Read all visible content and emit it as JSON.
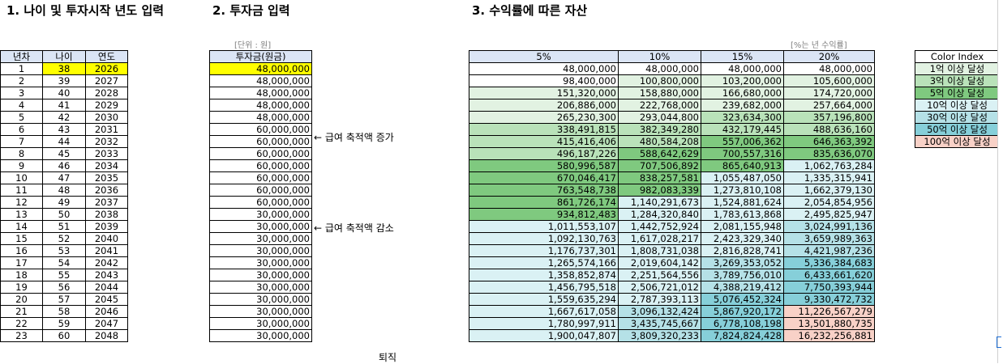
{
  "headings": {
    "h1": "1. 나이 및 투자시작 년도 입력",
    "h2": "2. 투자금 입력",
    "h3": "3. 수익률에 따른 자산"
  },
  "units": {
    "invest": "[단위 : 원]",
    "rate": "[%는 년 수익률]"
  },
  "age_table": {
    "headers": [
      "년차",
      "나이",
      "연도"
    ],
    "rows": [
      [
        "1",
        "38",
        "2026"
      ],
      [
        "2",
        "39",
        "2027"
      ],
      [
        "3",
        "40",
        "2028"
      ],
      [
        "4",
        "41",
        "2029"
      ],
      [
        "5",
        "42",
        "2030"
      ],
      [
        "6",
        "43",
        "2031"
      ],
      [
        "7",
        "44",
        "2032"
      ],
      [
        "8",
        "45",
        "2033"
      ],
      [
        "9",
        "46",
        "2034"
      ],
      [
        "10",
        "47",
        "2035"
      ],
      [
        "11",
        "48",
        "2036"
      ],
      [
        "12",
        "49",
        "2037"
      ],
      [
        "13",
        "50",
        "2038"
      ],
      [
        "14",
        "51",
        "2039"
      ],
      [
        "15",
        "52",
        "2040"
      ],
      [
        "16",
        "53",
        "2041"
      ],
      [
        "17",
        "54",
        "2042"
      ],
      [
        "18",
        "55",
        "2043"
      ],
      [
        "19",
        "56",
        "2044"
      ],
      [
        "20",
        "57",
        "2045"
      ],
      [
        "21",
        "58",
        "2046"
      ],
      [
        "22",
        "59",
        "2047"
      ],
      [
        "23",
        "60",
        "2048"
      ]
    ]
  },
  "invest_table": {
    "header": "투자금(원금)",
    "values": [
      "48,000,000",
      "48,000,000",
      "48,000,000",
      "48,000,000",
      "48,000,000",
      "60,000,000",
      "60,000,000",
      "60,000,000",
      "60,000,000",
      "60,000,000",
      "60,000,000",
      "60,000,000",
      "30,000,000",
      "30,000,000",
      "30,000,000",
      "30,000,000",
      "30,000,000",
      "30,000,000",
      "30,000,000",
      "30,000,000",
      "30,000,000",
      "30,000,000",
      "30,000,000"
    ]
  },
  "notes": {
    "increase": "← 급여 축적액 증가",
    "decrease": "← 급여 축적액 감소",
    "retire": "퇴직"
  },
  "returns_table": {
    "headers": [
      "5%",
      "10%",
      "15%",
      "20%"
    ],
    "rows": [
      [
        "48,000,000",
        "48,000,000",
        "48,000,000",
        "48,000,000"
      ],
      [
        "98,400,000",
        "100,800,000",
        "103,200,000",
        "105,600,000"
      ],
      [
        "151,320,000",
        "158,880,000",
        "166,680,000",
        "174,720,000"
      ],
      [
        "206,886,000",
        "222,768,000",
        "239,682,000",
        "257,664,000"
      ],
      [
        "265,230,300",
        "293,044,800",
        "323,634,300",
        "357,196,800"
      ],
      [
        "338,491,815",
        "382,349,280",
        "432,179,445",
        "488,636,160"
      ],
      [
        "415,416,406",
        "480,584,208",
        "557,006,362",
        "646,363,392"
      ],
      [
        "496,187,226",
        "588,642,629",
        "700,557,316",
        "835,636,070"
      ],
      [
        "580,996,587",
        "707,506,892",
        "865,640,913",
        "1,062,763,284"
      ],
      [
        "670,046,417",
        "838,257,581",
        "1,055,487,050",
        "1,335,315,941"
      ],
      [
        "763,548,738",
        "982,083,339",
        "1,273,810,108",
        "1,662,379,130"
      ],
      [
        "861,726,174",
        "1,140,291,673",
        "1,524,881,624",
        "2,054,854,956"
      ],
      [
        "934,812,483",
        "1,284,320,840",
        "1,783,613,868",
        "2,495,825,947"
      ],
      [
        "1,011,553,107",
        "1,442,752,924",
        "2,081,155,948",
        "3,024,991,136"
      ],
      [
        "1,092,130,763",
        "1,617,028,217",
        "2,423,329,340",
        "3,659,989,363"
      ],
      [
        "1,176,737,301",
        "1,808,731,038",
        "2,816,828,741",
        "4,421,987,236"
      ],
      [
        "1,265,574,166",
        "2,019,604,142",
        "3,269,353,052",
        "5,336,384,683"
      ],
      [
        "1,358,852,874",
        "2,251,564,556",
        "3,789,756,010",
        "6,433,661,620"
      ],
      [
        "1,456,795,518",
        "2,506,721,012",
        "4,388,219,412",
        "7,750,393,944"
      ],
      [
        "1,559,635,294",
        "2,787,393,113",
        "5,076,452,324",
        "9,330,472,732"
      ],
      [
        "1,667,617,058",
        "3,096,132,424",
        "5,867,920,172",
        "11,226,567,279"
      ],
      [
        "1,780,997,911",
        "3,435,745,667",
        "6,778,108,198",
        "13,501,880,735"
      ],
      [
        "1,900,047,807",
        "3,809,320,233",
        "7,824,824,428",
        "16,232,256,881"
      ]
    ]
  },
  "color_index": {
    "title": "Color Index",
    "items": [
      {
        "label": "1억 이상 달성",
        "color": "#e2f2e2"
      },
      {
        "label": "3억 이상 달성",
        "color": "#b9e2b9"
      },
      {
        "label": "5억 이상 달성",
        "color": "#7fc97f"
      },
      {
        "label": "10억 이상 달성",
        "color": "#daf1f4"
      },
      {
        "label": "30억 이상 달성",
        "color": "#b5e1e7"
      },
      {
        "label": "50억 이상 달성",
        "color": "#86cfd9"
      },
      {
        "label": "100억 이상 달성",
        "color": "#f8d1c7"
      }
    ]
  }
}
